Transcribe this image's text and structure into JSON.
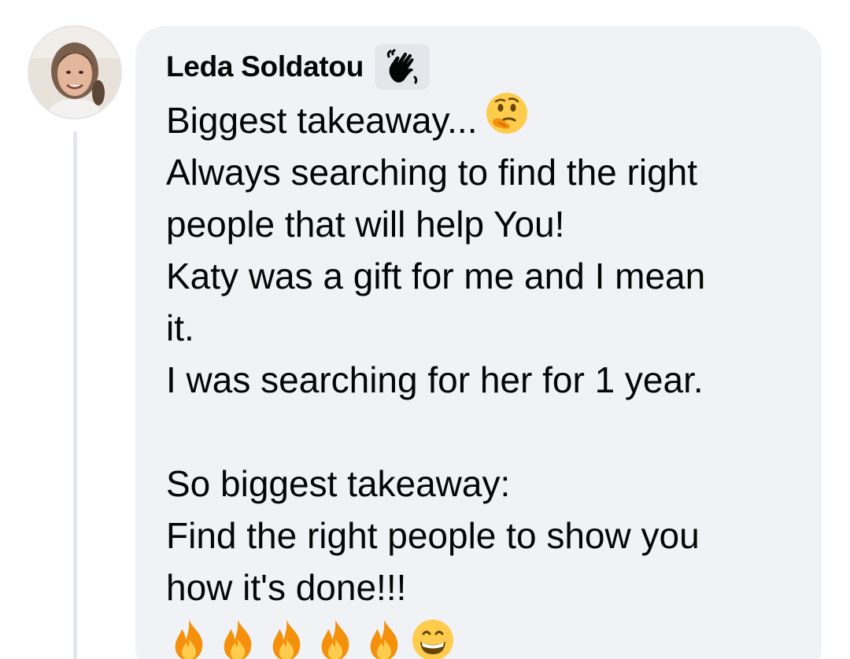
{
  "comment": {
    "author": "Leda Soldatou",
    "author_badge_icon": "waving-hand-badge-icon",
    "avatar_icon": "profile-photo",
    "lines": [
      "Biggest takeaway...",
      "Always searching to find the right",
      "people that will help You!",
      "Katy was a gift for me and I mean",
      "it.",
      "I was searching for her for 1 year.",
      "",
      "So biggest takeaway:",
      "Find the right people to show you",
      "how it's done!!!"
    ],
    "inline_emoji": "thinking-face-icon",
    "trailing_emojis": [
      "fire-icon",
      "fire-icon",
      "fire-icon",
      "fire-icon",
      "fire-icon",
      "grinning-face-icon"
    ]
  },
  "colors": {
    "bubble_bg": "#f0f2f5",
    "text": "#050505",
    "badge_bg": "#e4e6eb",
    "thread_line": "#e4e6eb"
  }
}
